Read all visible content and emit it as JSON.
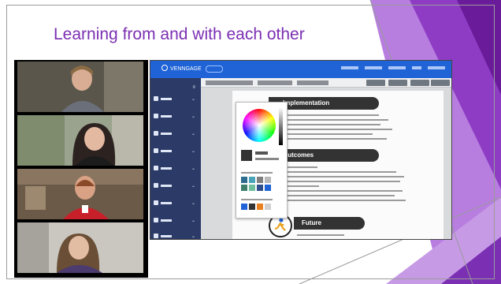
{
  "slide": {
    "title": "Learning from and with each other"
  },
  "app": {
    "logo_text": "VENNGAGE",
    "sidebar_count": 9
  },
  "document": {
    "heading_implementation": "Implementation",
    "heading_outcomes": "Outcomes",
    "heading_future": "Future"
  },
  "colors": {
    "title": "#7b2fb3",
    "app_topbar": "#1f63d6",
    "app_sidebar": "#2b3a66",
    "purple_dark": "#6a1b9a",
    "purple_mid": "#8e3cc4",
    "purple_light": "#b77ee0"
  }
}
